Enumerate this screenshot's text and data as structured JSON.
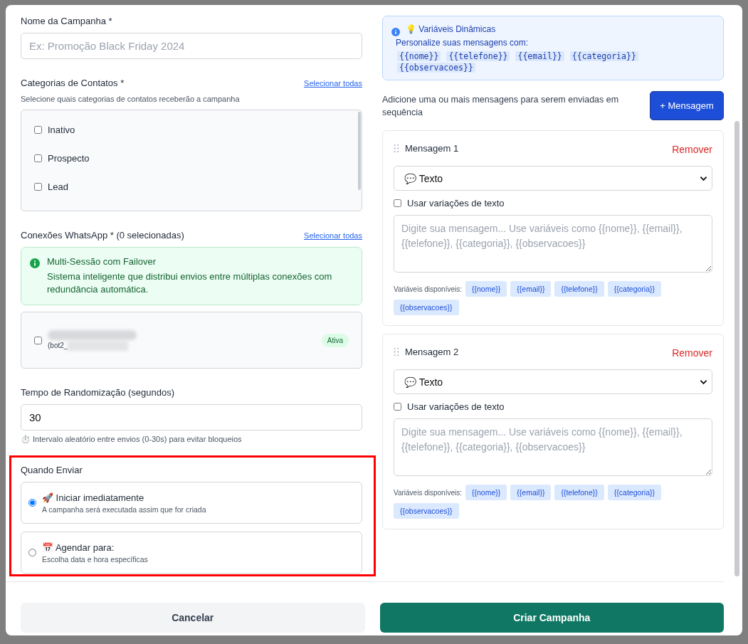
{
  "campaign_name": {
    "label": "Nome da Campanha *",
    "placeholder": "Ex: Promoção Black Friday 2024"
  },
  "categories": {
    "label": "Categorias de Contatos *",
    "select_all": "Selecionar todas",
    "hint": "Selecione quais categorias de contatos receberão a campanha",
    "items": [
      {
        "label": "Inativo",
        "checked": false
      },
      {
        "label": "Prospecto",
        "checked": false
      },
      {
        "label": "Lead",
        "checked": false
      }
    ]
  },
  "connections": {
    "label": "Conexões WhatsApp * (0 selecionadas)",
    "select_all": "Selecionar todas",
    "notice": {
      "title": "Multi-Sessão com Failover",
      "text": "Sistema inteligente que distribui envios entre múltiplas conexões com redundância automática."
    },
    "items": [
      {
        "detail": "(bot2_",
        "checked": false,
        "status": "Ativa",
        "redacted": true
      }
    ]
  },
  "randomization": {
    "label": "Tempo de Randomização (segundos)",
    "value": "30",
    "hint": "⏱️ Intervalo aleatório entre envios (0-30s) para evitar bloqueios"
  },
  "when_to_send": {
    "label": "Quando Enviar",
    "highlighted": true,
    "options": [
      {
        "title": "🚀 Iniciar imediatamente",
        "subtitle": "A campanha será executada assim que for criada",
        "selected": true
      },
      {
        "title": "📅 Agendar para:",
        "subtitle": "Escolha data e hora específicas",
        "selected": false
      }
    ]
  },
  "variables_info": {
    "title": "💡 Variáveis Dinâmicas",
    "text": "Personalize suas mensagens com:",
    "variables": [
      "{{nome}}",
      "{{telefone}}",
      "{{email}}",
      "{{categoria}}",
      "{{observacoes}}"
    ]
  },
  "messages_intro": "Adicione uma ou mais mensagens para serem enviadas em sequência",
  "add_message_button": "+ Mensagem",
  "messages": [
    {
      "title": "Mensagem 1",
      "remove": "Remover",
      "type": "💬 Texto",
      "use_variations": {
        "label": "Usar variações de texto",
        "checked": false
      },
      "placeholder": "Digite sua mensagem... Use variáveis como {{nome}}, {{email}}, {{telefone}}, {{categoria}}, {{observacoes}}",
      "variables_label": "Variáveis disponíveis:",
      "variables": [
        "{{nome}}",
        "{{email}}",
        "{{telefone}}",
        "{{categoria}}",
        "{{observacoes}}"
      ]
    },
    {
      "title": "Mensagem 2",
      "remove": "Remover",
      "type": "💬 Texto",
      "use_variations": {
        "label": "Usar variações de texto",
        "checked": false
      },
      "placeholder": "Digite sua mensagem... Use variáveis como {{nome}}, {{email}}, {{telefone}}, {{categoria}}, {{observacoes}}",
      "variables_label": "Variáveis disponíveis:",
      "variables": [
        "{{nome}}",
        "{{email}}",
        "{{telefone}}",
        "{{categoria}}",
        "{{observacoes}}"
      ]
    }
  ],
  "buttons": {
    "cancel": "Cancelar",
    "submit": "Criar Campanha"
  }
}
